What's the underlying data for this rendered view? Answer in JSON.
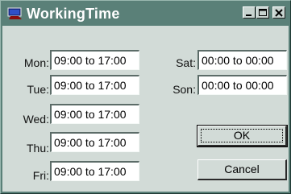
{
  "window": {
    "title": "WorkingTime"
  },
  "days": [
    {
      "label": "Mon:",
      "value": "09:00  to  17:00"
    },
    {
      "label": "Tue:",
      "value": "09:00  to  17:00"
    },
    {
      "label": "Wed:",
      "value": "09:00  to  17:00"
    },
    {
      "label": "Thu:",
      "value": "09:00  to  17:00"
    },
    {
      "label": "Fri:",
      "value": "09:00  to  17:00"
    },
    {
      "label": "Sat:",
      "value": "00:00  to  00:00"
    },
    {
      "label": "Son:",
      "value": "00:00  to  00:00"
    }
  ],
  "buttons": {
    "ok": "OK",
    "cancel": "Cancel"
  },
  "icons": {
    "app": "monitor-icon",
    "minimize": "minimize-icon",
    "maximize": "maximize-icon",
    "close": "close-icon"
  },
  "colors": {
    "titlebar": "#5a8078",
    "client": "#d2dbd7"
  }
}
